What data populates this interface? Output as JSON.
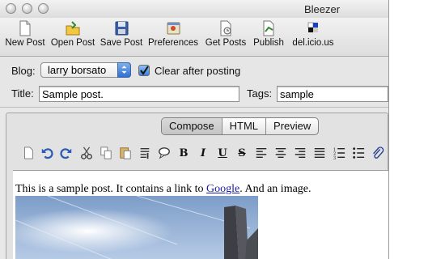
{
  "window": {
    "title": "Bleezer"
  },
  "toolbar": {
    "items": [
      {
        "label": "New Post",
        "icon": "new-post-icon"
      },
      {
        "label": "Open Post",
        "icon": "open-post-icon"
      },
      {
        "label": "Save Post",
        "icon": "save-post-icon"
      },
      {
        "label": "Preferences",
        "icon": "preferences-icon"
      },
      {
        "label": "Get Posts",
        "icon": "get-posts-icon"
      },
      {
        "label": "Publish",
        "icon": "publish-icon"
      },
      {
        "label": "del.icio.us",
        "icon": "delicious-icon"
      }
    ]
  },
  "form": {
    "blog_label": "Blog:",
    "blog_value": "larry borsato",
    "clear_label": "Clear after posting",
    "clear_checked": true,
    "title_label": "Title:",
    "title_value": "Sample post.",
    "tags_label": "Tags:",
    "tags_value": "sample"
  },
  "editor": {
    "tabs": [
      {
        "label": "Compose",
        "selected": true
      },
      {
        "label": "HTML",
        "selected": false
      },
      {
        "label": "Preview",
        "selected": false
      }
    ],
    "format_buttons": {
      "bold": "B",
      "italic": "I",
      "underline": "U",
      "strike": "S"
    },
    "content": {
      "text_before": "This is a sample post. It contains a link to ",
      "link_text": "Google",
      "text_after": ". And an image."
    }
  },
  "colors": {
    "accent": "#2f6fd0",
    "link": "#1a1aa6"
  }
}
